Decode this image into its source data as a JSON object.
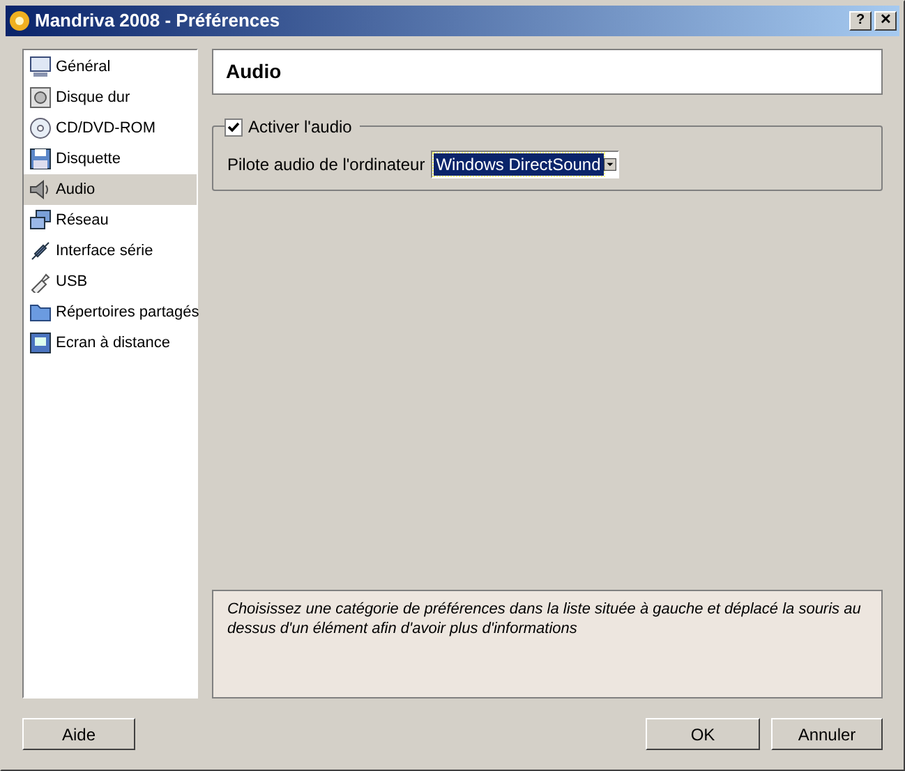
{
  "window": {
    "title": "Mandriva 2008 - Préférences",
    "buttons": [
      {
        "label": "?"
      },
      {
        "label": "✕"
      }
    ]
  },
  "sidebar": {
    "items": [
      {
        "label": "Général",
        "selected": false
      },
      {
        "label": "Disque dur",
        "selected": false
      },
      {
        "label": "CD/DVD-ROM",
        "selected": false
      },
      {
        "label": "Disquette",
        "selected": false
      },
      {
        "label": "Audio",
        "selected": true
      },
      {
        "label": "Réseau",
        "selected": false
      },
      {
        "label": "Interface série",
        "selected": false
      },
      {
        "label": "USB",
        "selected": false
      },
      {
        "label": "Répertoires partagés",
        "selected": false
      },
      {
        "label": "Ecran à distance",
        "selected": false
      }
    ]
  },
  "header": "Audio",
  "audio_group": {
    "checkbox": {
      "label": "Activer l'audio",
      "checked": true
    },
    "driver_label": "Pilote audio de l'ordinateur",
    "driver_value": "Windows DirectSound"
  },
  "info": "Choisissez une catégorie de préférences dans la liste située à gauche et déplacé la souris au dessus d'un élément afin d'avoir plus d'informations",
  "buttons": [
    {
      "label": "Aide"
    },
    {
      "label": "OK"
    },
    {
      "label": "Annuler"
    }
  ]
}
